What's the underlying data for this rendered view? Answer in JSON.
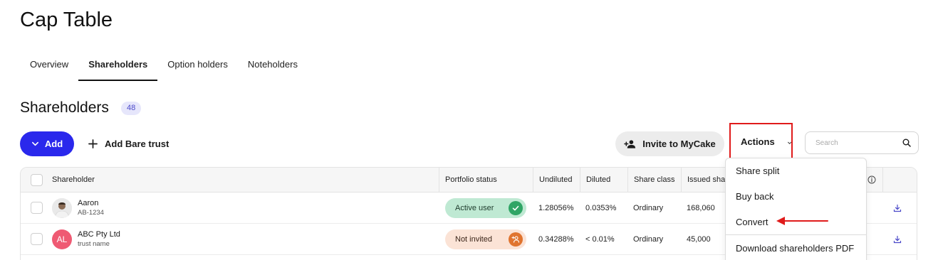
{
  "page": {
    "title": "Cap Table"
  },
  "tabs": [
    {
      "label": "Overview",
      "active": false
    },
    {
      "label": "Shareholders",
      "active": true
    },
    {
      "label": "Option holders",
      "active": false
    },
    {
      "label": "Noteholders",
      "active": false
    }
  ],
  "section": {
    "title": "Shareholders",
    "count": "48"
  },
  "toolbar": {
    "add_label": "Add",
    "bare_trust_label": "Add Bare trust",
    "invite_label": "Invite to MyCake",
    "actions_label": "Actions",
    "search_placeholder": "Search"
  },
  "table": {
    "columns": [
      "Shareholder",
      "Portfolio status",
      "Undiluted",
      "Diluted",
      "Share class",
      "Issued sha"
    ],
    "rows": [
      {
        "name": "Aaron",
        "sub": "AB-1234",
        "avatar": "photo",
        "status": "Active user",
        "status_kind": "active",
        "undiluted": "1.28056%",
        "diluted": "0.0353%",
        "share_class": "Ordinary",
        "issued": "168,060"
      },
      {
        "name": "ABC Pty Ltd",
        "sub": "trust name",
        "avatar": "AL",
        "status": "Not invited",
        "status_kind": "invited",
        "undiluted": "0.34288%",
        "diluted": "< 0.01%",
        "share_class": "Ordinary",
        "issued": "45,000"
      }
    ]
  },
  "actions_menu": {
    "items": [
      "Share split",
      "Buy back",
      "Convert",
      "Download shareholders PDF"
    ]
  },
  "colors": {
    "primary": "#2a28ec",
    "highlight": "#e01b1b",
    "active_status": "#2fa565",
    "invite_status": "#e0742f"
  }
}
